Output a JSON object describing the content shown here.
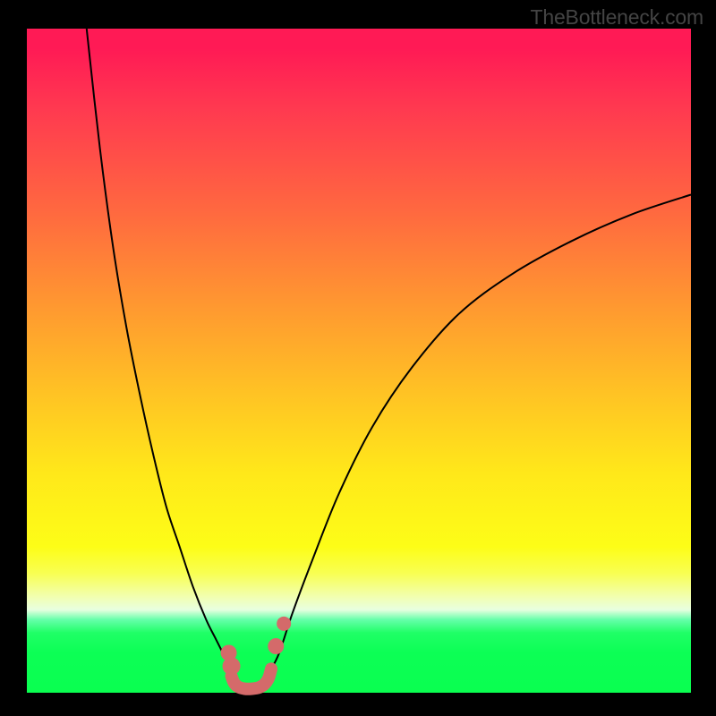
{
  "watermark": "TheBottleneck.com",
  "chart_data": {
    "type": "line",
    "title": "",
    "xlabel": "",
    "ylabel": "",
    "xlim": [
      0,
      100
    ],
    "ylim": [
      0,
      100
    ],
    "grid": false,
    "legend": false,
    "background_gradient": {
      "stops": [
        {
          "pos": 0.0,
          "color": "#ff1a55"
        },
        {
          "pos": 0.12,
          "color": "#ff3950"
        },
        {
          "pos": 0.28,
          "color": "#ff6a3f"
        },
        {
          "pos": 0.42,
          "color": "#ff9930"
        },
        {
          "pos": 0.55,
          "color": "#ffc324"
        },
        {
          "pos": 0.67,
          "color": "#ffe81a"
        },
        {
          "pos": 0.78,
          "color": "#fdfd17"
        },
        {
          "pos": 0.86,
          "color": "#f3ffb0"
        },
        {
          "pos": 0.89,
          "color": "#66ffaa"
        },
        {
          "pos": 0.94,
          "color": "#0cff55"
        },
        {
          "pos": 1.0,
          "color": "#0aff50"
        }
      ]
    },
    "series": [
      {
        "name": "left-branch",
        "color": "#000000",
        "width": 2,
        "x": [
          9,
          11,
          13,
          15,
          17,
          19,
          21,
          23,
          25,
          27,
          28.5,
          30,
          31
        ],
        "y": [
          100,
          82,
          67,
          55,
          45,
          36,
          28,
          22,
          16,
          11,
          8,
          5,
          3
        ]
      },
      {
        "name": "right-branch",
        "color": "#000000",
        "width": 2,
        "x": [
          36.5,
          38,
          40,
          43,
          47,
          52,
          58,
          65,
          73,
          82,
          91,
          100
        ],
        "y": [
          3,
          6,
          12,
          20,
          30,
          40,
          49,
          57,
          63,
          68,
          72,
          75
        ]
      },
      {
        "name": "bottom-bumps",
        "color": "#d46a6a",
        "width": 14,
        "linecap": "round",
        "x": [
          30.8,
          31.2,
          31.8,
          32.8,
          33.9,
          35.0,
          35.8,
          36.4,
          36.8
        ],
        "y": [
          2.5,
          1.5,
          0.9,
          0.6,
          0.6,
          0.8,
          1.3,
          2.2,
          3.6
        ]
      }
    ],
    "markers": [
      {
        "name": "left-bump-top",
        "x": 30.4,
        "y": 6.0,
        "r": 9,
        "color": "#d46a6a"
      },
      {
        "name": "left-bump-mid",
        "x": 30.8,
        "y": 4.0,
        "r": 10,
        "color": "#d46a6a"
      },
      {
        "name": "right-bump-high",
        "x": 37.5,
        "y": 7.0,
        "r": 9,
        "color": "#d46a6a"
      },
      {
        "name": "right-bump-dot",
        "x": 38.7,
        "y": 10.4,
        "r": 8,
        "color": "#d46a6a"
      }
    ]
  }
}
